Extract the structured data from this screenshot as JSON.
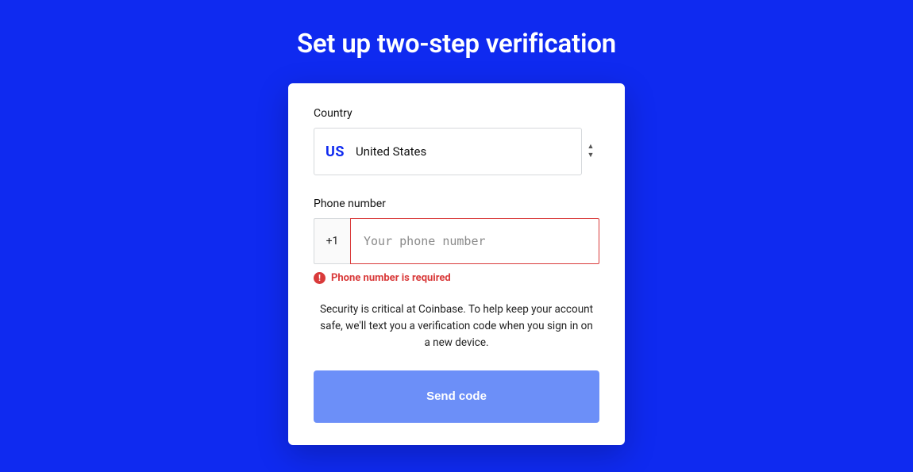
{
  "page": {
    "title": "Set up two-step verification"
  },
  "country": {
    "label": "Country",
    "selected_code": "US",
    "selected_name": "United States"
  },
  "phone": {
    "label": "Phone number",
    "calling_code": "+1",
    "value": "",
    "placeholder": "Your phone number"
  },
  "error": {
    "message": "Phone number is required"
  },
  "helper": {
    "text": "Security is critical at Coinbase. To help keep your account safe, we'll text you a verification code when you sign in on a new device."
  },
  "actions": {
    "send_label": "Send code"
  },
  "colors": {
    "background": "#0F2AF0",
    "error": "#d93a3a",
    "button": "#6C8FF8"
  }
}
